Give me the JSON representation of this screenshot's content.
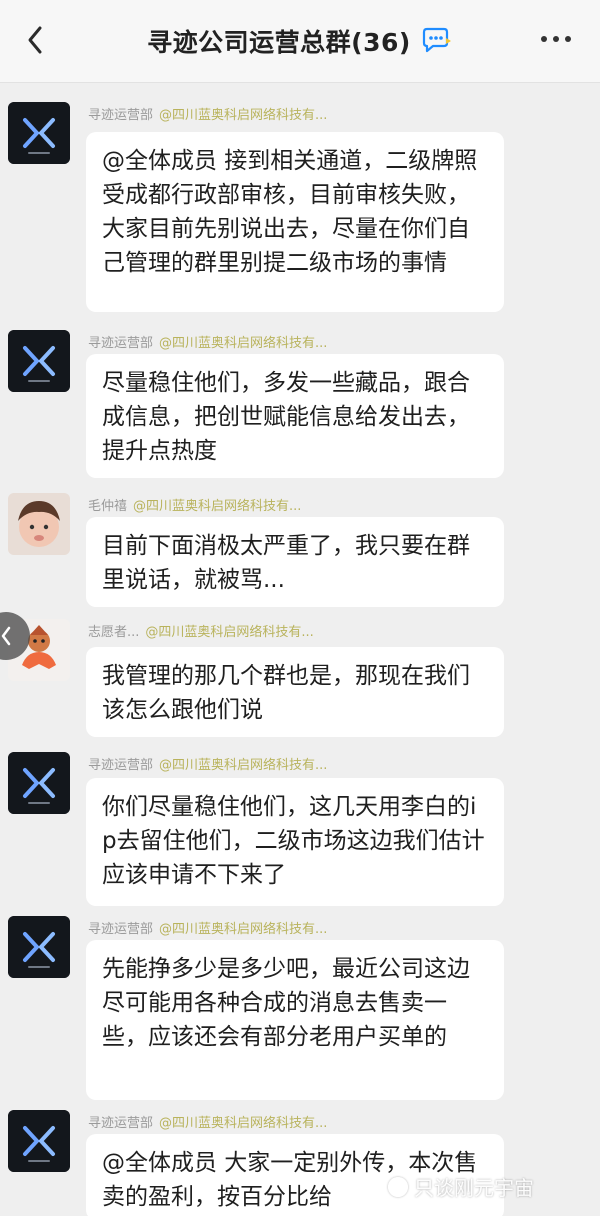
{
  "header": {
    "title": "寻迹公司运营总群(36)",
    "back_icon": "back-arrow-icon",
    "chat_icon": "chat-bubble-icon",
    "more_icon": "more-icon"
  },
  "messages": [
    {
      "sender": "寻迹运营部",
      "mention": "@四川蓝奥科启网络科技有...",
      "avatar": "company-logo-icon",
      "text": "@全体成员 接到相关通道，二级牌照受成都行政部审核，目前审核失败，大家目前先别说出去，尽量在你们自己管理的群里别提二级市场的事情"
    },
    {
      "sender": "寻迹运营部",
      "mention": "@四川蓝奥科启网络科技有...",
      "avatar": "company-logo-icon",
      "text": "尽量稳住他们，多发一些藏品，跟合成信息，把创世赋能信息给发出去，提升点热度"
    },
    {
      "sender": "毛仲禧",
      "mention": "@四川蓝奥科启网络科技有...",
      "avatar": "child-avatar-icon",
      "text": "目前下面消极太严重了，我只要在群里说话，就被骂..."
    },
    {
      "sender": "志愿者...",
      "mention": "@四川蓝奥科启网络科技有...",
      "avatar": "mascot-avatar-icon",
      "text": "我管理的那几个群也是，那现在我们该怎么跟他们说"
    },
    {
      "sender": "寻迹运营部",
      "mention": "@四川蓝奥科启网络科技有...",
      "avatar": "company-logo-icon",
      "text": "你们尽量稳住他们，这几天用李白的ip去留住他们，二级市场这边我们估计应该申请不下来了"
    },
    {
      "sender": "寻迹运营部",
      "mention": "@四川蓝奥科启网络科技有...",
      "avatar": "company-logo-icon",
      "text": "先能挣多少是多少吧，最近公司这边尽可能用各种合成的消息去售卖一些，应该还会有部分老用户买单的"
    },
    {
      "sender": "寻迹运营部",
      "mention": "@四川蓝奥科启网络科技有...",
      "avatar": "company-logo-icon",
      "text": "@全体成员 大家一定别外传，本次售卖的盈利，按百分比给"
    }
  ],
  "watermark": {
    "text": "只谈刚元宇宙"
  }
}
